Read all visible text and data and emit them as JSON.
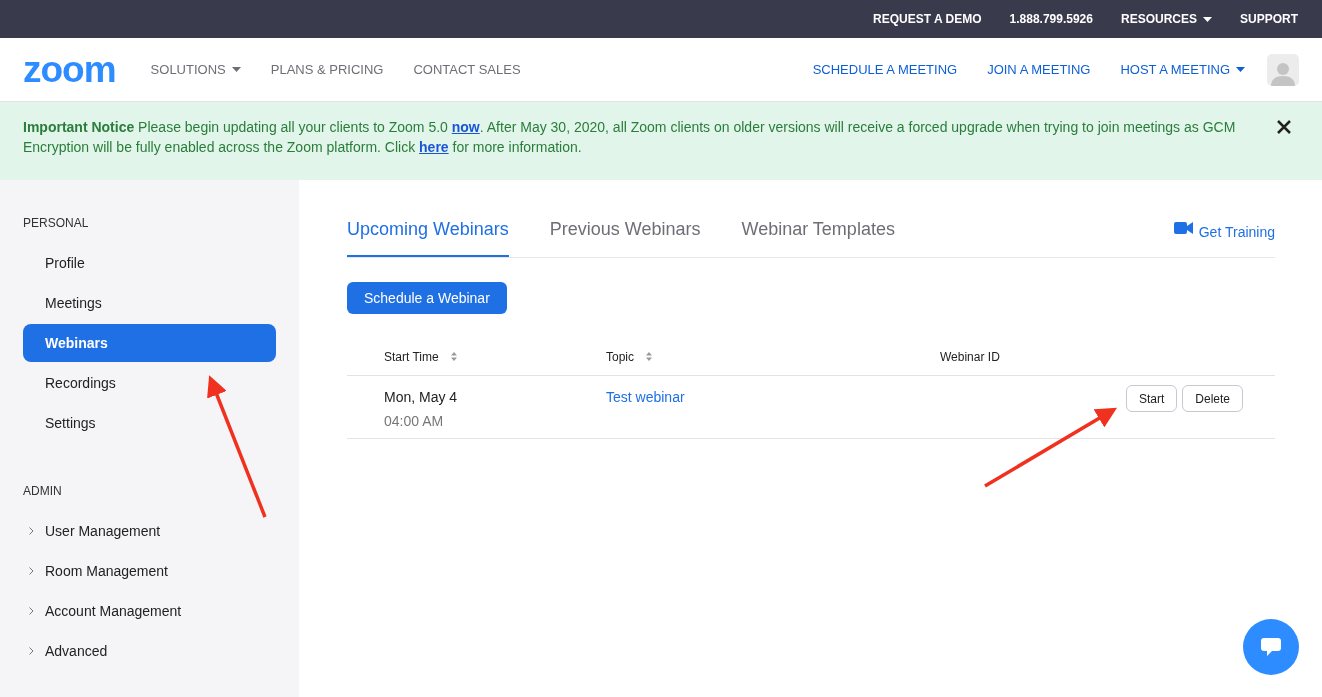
{
  "top_bar": {
    "links": [
      {
        "label": "REQUEST A DEMO",
        "has_caret": false
      },
      {
        "label": "1.888.799.5926",
        "has_caret": false
      },
      {
        "label": "RESOURCES",
        "has_caret": true
      },
      {
        "label": "SUPPORT",
        "has_caret": false
      }
    ]
  },
  "header": {
    "logo": "zoom",
    "nav": [
      {
        "label": "SOLUTIONS",
        "has_caret": true
      },
      {
        "label": "PLANS & PRICING",
        "has_caret": false
      },
      {
        "label": "CONTACT SALES",
        "has_caret": false
      }
    ],
    "actions": [
      {
        "label": "SCHEDULE A MEETING",
        "has_caret": false
      },
      {
        "label": "JOIN A MEETING",
        "has_caret": false
      },
      {
        "label": "HOST A MEETING",
        "has_caret": true
      }
    ]
  },
  "notice": {
    "parts": [
      {
        "kind": "bold",
        "text": "Important Notice"
      },
      {
        "kind": "text",
        "text": " Please begin updating all your clients to Zoom 5.0 "
      },
      {
        "kind": "link",
        "text": "now"
      },
      {
        "kind": "text",
        "text": ". After May 30, 2020, all Zoom clients on older versions will receive a forced upgrade when trying to join meetings as GCM Encryption will be fully enabled across the Zoom platform. Click "
      },
      {
        "kind": "link",
        "text": "here"
      },
      {
        "kind": "text",
        "text": " for more information."
      }
    ]
  },
  "sidebar": {
    "sections": [
      {
        "title": "PERSONAL",
        "items": [
          {
            "label": "Profile",
            "selected": false,
            "expandable": false
          },
          {
            "label": "Meetings",
            "selected": false,
            "expandable": false
          },
          {
            "label": "Webinars",
            "selected": true,
            "expandable": false
          },
          {
            "label": "Recordings",
            "selected": false,
            "expandable": false
          },
          {
            "label": "Settings",
            "selected": false,
            "expandable": false
          }
        ]
      },
      {
        "title": "ADMIN",
        "items": [
          {
            "label": "User Management",
            "selected": false,
            "expandable": true
          },
          {
            "label": "Room Management",
            "selected": false,
            "expandable": true
          },
          {
            "label": "Account Management",
            "selected": false,
            "expandable": true
          },
          {
            "label": "Advanced",
            "selected": false,
            "expandable": true
          }
        ]
      }
    ]
  },
  "tabs": [
    {
      "label": "Upcoming Webinars",
      "selected": true
    },
    {
      "label": "Previous Webinars",
      "selected": false
    },
    {
      "label": "Webinar Templates",
      "selected": false
    }
  ],
  "get_training": "Get Training",
  "schedule_button": "Schedule a Webinar",
  "table": {
    "columns": [
      {
        "label": "Start Time",
        "sortable": true
      },
      {
        "label": "Topic",
        "sortable": true
      },
      {
        "label": "Webinar ID",
        "sortable": false
      }
    ],
    "rows": [
      {
        "date": "Mon, May 4",
        "time": "04:00 AM",
        "topic": "Test webinar",
        "actions": [
          "Start",
          "Delete"
        ]
      }
    ]
  }
}
